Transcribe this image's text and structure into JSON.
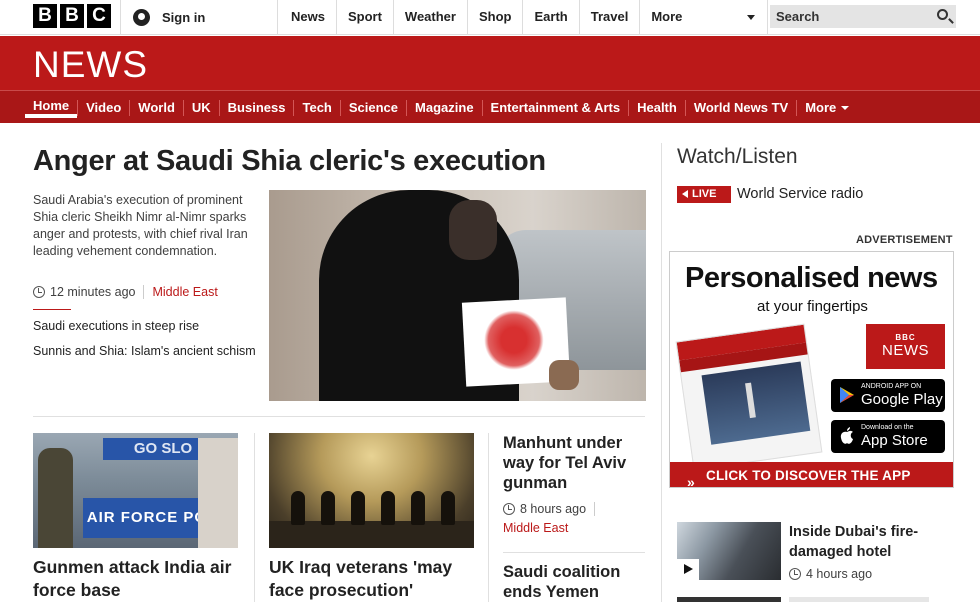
{
  "brand": {
    "logo_letters": [
      "B",
      "B",
      "C"
    ],
    "section": "NEWS"
  },
  "topbar": {
    "signin": "Sign in",
    "nav": [
      "News",
      "Sport",
      "Weather",
      "Shop",
      "Earth",
      "Travel",
      "More"
    ],
    "search_placeholder": "Search"
  },
  "sections": [
    "Home",
    "Video",
    "World",
    "UK",
    "Business",
    "Tech",
    "Science",
    "Magazine",
    "Entertainment & Arts",
    "Health",
    "World News TV",
    "More"
  ],
  "top_story": {
    "headline": "Anger at Saudi Shia cleric's execution",
    "summary": "Saudi Arabia's execution of prominent Shia cleric Sheikh Nimr al-Nimr sparks anger and protests, with chief rival Iran leading vehement condemnation.",
    "time": "12 minutes ago",
    "tag": "Middle East",
    "related": [
      "Saudi executions in steep rise",
      "Sunnis and Shia: Islam's ancient schism"
    ]
  },
  "stories": [
    {
      "title": "Gunmen attack India air force base",
      "image_text": [
        "GO SLO",
        "AIR FORCE POLIC"
      ]
    },
    {
      "title": "UK Iraq veterans 'may face prosecution'"
    },
    {
      "title": "Manhunt under way for Tel Aviv gunman",
      "time": "8 hours ago",
      "tag": "Middle East"
    },
    {
      "title": "Saudi coalition ends Yemen"
    }
  ],
  "sidebar": {
    "watch_title": "Watch/Listen",
    "live_label": "LIVE",
    "radio": "World Service radio",
    "ad_label": "ADVERTISEMENT",
    "ad": {
      "title": "Personalised news",
      "subtitle": "at your fingertips",
      "bbc": "BBC",
      "news": "NEWS",
      "google_small": "ANDROID APP ON",
      "google_big": "Google Play",
      "apple_small": "Download on the",
      "apple_big": "App Store",
      "cta": "CLICK TO DISCOVER THE APP"
    },
    "video_story": {
      "title": "Inside Dubai's fire-damaged hotel",
      "time": "4 hours ago"
    }
  },
  "colors": {
    "accent": "#bb1919",
    "nav_dark": "#a91717"
  }
}
